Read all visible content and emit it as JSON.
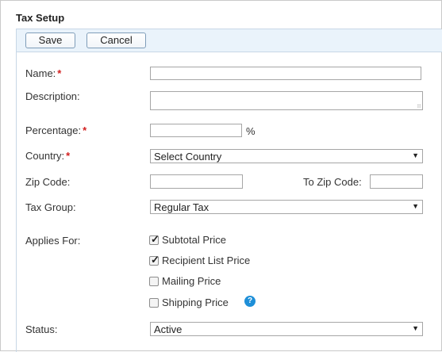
{
  "page": {
    "title": "Tax Setup"
  },
  "toolbar": {
    "save_label": "Save",
    "cancel_label": "Cancel"
  },
  "form": {
    "name": {
      "label": "Name:",
      "required": "*",
      "value": ""
    },
    "description": {
      "label": "Description:",
      "value": ""
    },
    "percentage": {
      "label": "Percentage:",
      "required": "*",
      "value": "",
      "unit": "%"
    },
    "country": {
      "label": "Country:",
      "required": "*",
      "selected": "Select Country"
    },
    "zip_code": {
      "label": "Zip Code:",
      "value": ""
    },
    "to_zip_code": {
      "label": "To Zip Code:",
      "value": ""
    },
    "tax_group": {
      "label": "Tax Group:",
      "selected": "Regular Tax"
    },
    "applies_for": {
      "label": "Applies For:",
      "options": [
        {
          "label": "Subtotal Price",
          "checked": true
        },
        {
          "label": "Recipient List Price",
          "checked": true
        },
        {
          "label": "Mailing Price",
          "checked": false
        },
        {
          "label": "Shipping Price",
          "checked": false
        }
      ],
      "help_icon": "question-icon",
      "help_glyph": "?"
    },
    "status": {
      "label": "Status:",
      "selected": "Active"
    }
  },
  "colors": {
    "required": "#d21f1f",
    "toolbar_bg": "#eaf3fb",
    "help_icon": "#1e8fd8"
  }
}
